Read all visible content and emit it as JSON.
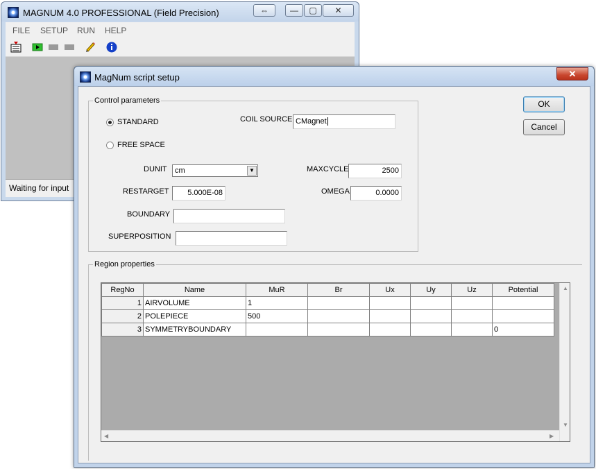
{
  "main_window": {
    "title": "MAGNUM 4.0 PROFESSIONAL (Field Precision)",
    "menu": [
      "FILE",
      "SETUP",
      "RUN",
      "HELP"
    ],
    "status": "Waiting for input",
    "title_buttons": {
      "snap": "⇔",
      "minimize": "—",
      "maximize": "▢",
      "close": "✕"
    }
  },
  "dialog": {
    "title": "MagNum script setup",
    "close_glyph": "✕",
    "control_group": "Control parameters",
    "radio_standard": "STANDARD",
    "radio_free_space": "FREE SPACE",
    "selected_mode": "STANDARD",
    "coil_source_label": "COIL SOURCE",
    "coil_source_value": "CMagnet",
    "dunit_label": "DUNIT",
    "dunit_value": "cm",
    "maxcycle_label": "MAXCYCLE",
    "maxcycle_value": "2500",
    "restarget_label": "RESTARGET",
    "restarget_value": "5.000E-08",
    "omega_label": "OMEGA",
    "omega_value": "0.0000",
    "boundary_label": "BOUNDARY",
    "boundary_value": "",
    "superposition_label": "SUPERPOSITION",
    "superposition_value": "",
    "ok_label": "OK",
    "cancel_label": "Cancel",
    "region_group": "Region properties",
    "columns": [
      "RegNo",
      "Name",
      "MuR",
      "Br",
      "Ux",
      "Uy",
      "Uz",
      "Potential"
    ],
    "rows": [
      [
        "1",
        "AIRVOLUME",
        "1",
        "",
        "",
        "",
        "",
        ""
      ],
      [
        "2",
        "POLEPIECE",
        "500",
        "",
        "",
        "",
        "",
        ""
      ],
      [
        "3",
        "SYMMETRYBOUNDARY",
        "",
        "",
        "",
        "",
        "",
        "0"
      ]
    ]
  }
}
